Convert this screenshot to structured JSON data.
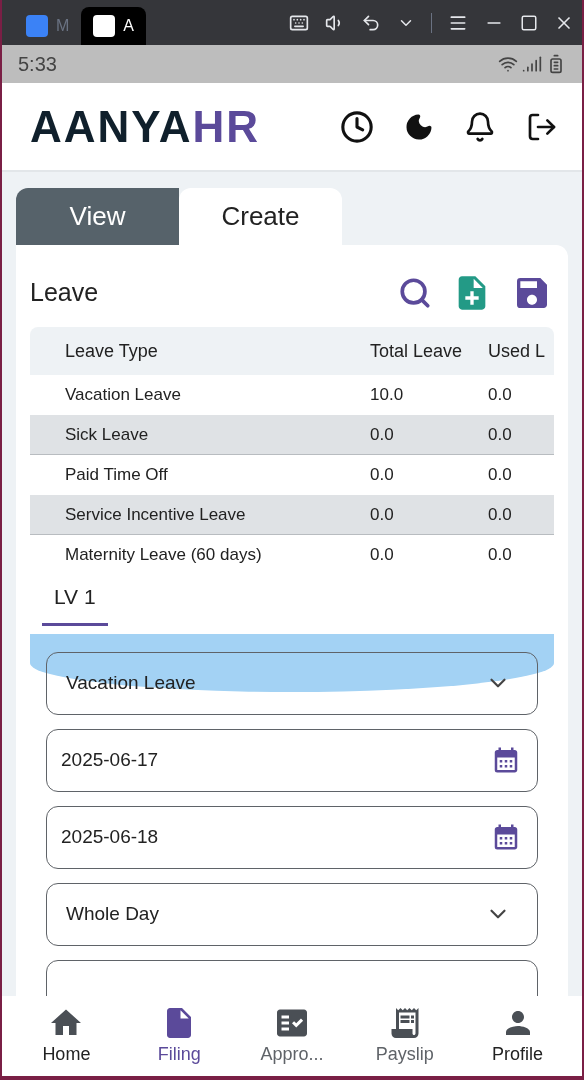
{
  "emulator_tabs": [
    {
      "label": "M",
      "selected": false
    },
    {
      "label": "A",
      "selected": true
    }
  ],
  "status_bar": {
    "time": "5:33"
  },
  "header": {
    "logo_dark": "AANYA",
    "logo_accent": "HR"
  },
  "tabs": [
    {
      "label": "View",
      "selected": false
    },
    {
      "label": "Create",
      "selected": true
    }
  ],
  "section_title": "Leave",
  "table": {
    "columns": [
      "Leave Type",
      "Total Leave",
      "Used L"
    ],
    "rows": [
      [
        "Vacation Leave",
        "10.0",
        "0.0"
      ],
      [
        "Sick Leave",
        "0.0",
        "0.0"
      ],
      [
        "Paid Time Off",
        "0.0",
        "0.0"
      ],
      [
        "Service Incentive Leave",
        "0.0",
        "0.0"
      ],
      [
        "Maternity Leave (60 days)",
        "0.0",
        "0.0"
      ]
    ]
  },
  "subtab": {
    "label": "LV 1",
    "selected": true
  },
  "form_fields": [
    {
      "kind": "select",
      "value": "Vacation Leave"
    },
    {
      "kind": "date",
      "value": "2025-06-17"
    },
    {
      "kind": "date",
      "value": "2025-06-18"
    },
    {
      "kind": "select",
      "value": "Whole Day"
    },
    {
      "kind": "select"
    }
  ],
  "bottom_nav": [
    {
      "label": "Home",
      "selected": false,
      "disabled": false
    },
    {
      "label": "Filing",
      "selected": true,
      "disabled": false
    },
    {
      "label": "Appro...",
      "selected": false,
      "disabled": true
    },
    {
      "label": "Payslip",
      "selected": false,
      "disabled": true
    },
    {
      "label": "Profile",
      "selected": false,
      "disabled": false
    }
  ]
}
